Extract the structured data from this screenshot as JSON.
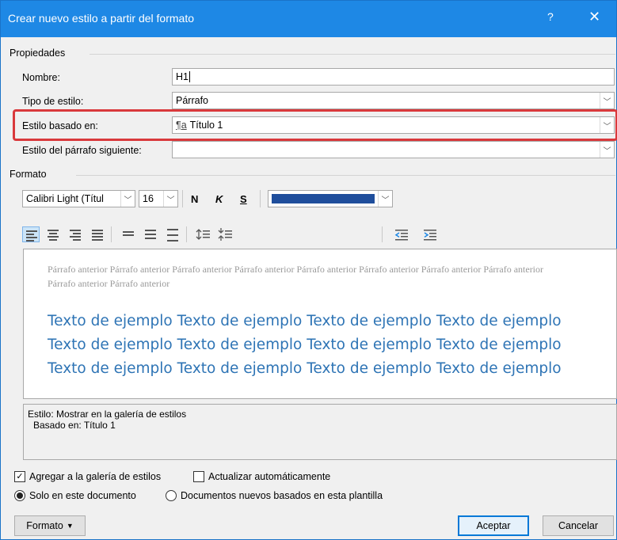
{
  "window": {
    "title": "Crear nuevo estilo a partir del formato",
    "help": "?",
    "close": "✕"
  },
  "properties": {
    "section_label": "Propiedades",
    "name_label": "Nombre:",
    "name_value": "H1",
    "type_label": "Tipo de estilo:",
    "type_value": "Párrafo",
    "based_label": "Estilo basado en:",
    "based_icon": "¶a",
    "based_value": "Título 1",
    "next_label": "Estilo del párrafo siguiente:",
    "next_value": ""
  },
  "format": {
    "section_label": "Formato",
    "font": "Calibri Light (Títul",
    "size": "16",
    "bold": "N",
    "italic": "K",
    "underline": "S",
    "font_color": "#1f4e9c"
  },
  "preview": {
    "previous_text": "Párrafo anterior Párrafo anterior Párrafo anterior Párrafo anterior Párrafo anterior Párrafo anterior Párrafo anterior Párrafo anterior Párrafo anterior Párrafo anterior",
    "sample_text": "Texto de ejemplo Texto de ejemplo Texto de ejemplo Texto de ejemplo Texto de ejemplo Texto de ejemplo Texto de ejemplo Texto de ejemplo Texto de ejemplo Texto de ejemplo Texto de ejemplo Texto de ejemplo",
    "sample_color": "#2e74b5"
  },
  "description": {
    "line1": "Estilo: Mostrar en la galería de estilos",
    "line2": "Basado en: Título 1"
  },
  "options": {
    "add_gallery": "Agregar a la galería de estilos",
    "add_gallery_checked": true,
    "auto_update": "Actualizar automáticamente",
    "auto_update_checked": false,
    "only_doc": "Solo en este documento",
    "new_docs": "Documentos nuevos basados en esta plantilla",
    "selected_scope": "only_doc"
  },
  "buttons": {
    "format": "Formato",
    "accept": "Aceptar",
    "cancel": "Cancelar"
  }
}
